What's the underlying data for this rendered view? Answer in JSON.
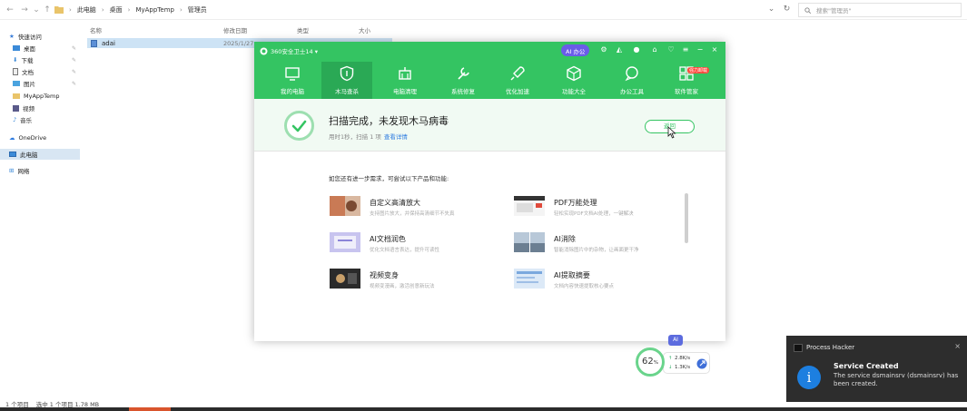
{
  "explorer": {
    "breadcrumbs": [
      "此电脑",
      "桌面",
      "MyAppTemp",
      "管理员"
    ],
    "search_placeholder": "搜索\"管理员\"",
    "columns": [
      "名称",
      "修改日期",
      "类型",
      "大小"
    ],
    "file": {
      "name": "adai",
      "date": "2025/1/27 ..."
    },
    "sidebar": [
      {
        "label": "快速访问",
        "icon": "star-icon"
      },
      {
        "label": "桌面",
        "icon": "desktop-icon",
        "pinned": true
      },
      {
        "label": "下载",
        "icon": "download-icon",
        "pinned": true
      },
      {
        "label": "文档",
        "icon": "document-icon",
        "pinned": true
      },
      {
        "label": "图片",
        "icon": "picture-icon",
        "pinned": true
      },
      {
        "label": "MyAppTemp",
        "icon": "folder-icon"
      },
      {
        "label": "视频",
        "icon": "video-icon"
      },
      {
        "label": "音乐",
        "icon": "music-icon"
      },
      {
        "label": "OneDrive",
        "icon": "cloud-icon"
      },
      {
        "label": "此电脑",
        "icon": "computer-icon",
        "selected": true
      },
      {
        "label": "网络",
        "icon": "network-icon"
      }
    ],
    "status": [
      "1 个项目",
      "选中 1 个项目 1.78 MB"
    ]
  },
  "app360": {
    "title": "360安全卫士14 ▾",
    "ai_button": "AI 办公",
    "tabs": [
      {
        "label": "我的电脑",
        "icon": "monitor-icon"
      },
      {
        "label": "木马查杀",
        "icon": "shield-icon",
        "selected": true
      },
      {
        "label": "电脑清理",
        "icon": "broom-icon"
      },
      {
        "label": "系统修复",
        "icon": "wrench-icon"
      },
      {
        "label": "优化加速",
        "icon": "rocket-icon"
      },
      {
        "label": "功能大全",
        "icon": "cube-icon"
      },
      {
        "label": "办公工具",
        "icon": "bubble-icon"
      },
      {
        "label": "软件管家",
        "icon": "apps-icon",
        "badge": "强力卸载"
      }
    ],
    "scan": {
      "title": "扫描完成，未发现木马病毒",
      "detail": "用时1秒，扫描 1 项",
      "link": "查看详情",
      "button": "返回"
    },
    "promo_heading": "如您还有进一步需求，可尝试以下产品和功能:",
    "promos": [
      {
        "title": "自定义高清放大",
        "desc": "支持图片放大，并保持高清细节不失真"
      },
      {
        "title": "PDF万能处理",
        "desc": "轻松实现PDF文档AI处理，一键解决"
      },
      {
        "title": "AI文档润色",
        "desc": "优化文档语言表达，提升可读性"
      },
      {
        "title": "AI消除",
        "desc": "智能消除图片中的杂物，让画面更干净"
      },
      {
        "title": "视频变身",
        "desc": "视频变漫画，激活创意新玩法"
      },
      {
        "title": "AI提取摘要",
        "desc": "文档内容快速提取核心要点"
      }
    ]
  },
  "widget": {
    "ai_label": "AI",
    "percent": "62",
    "percent_unit": "%",
    "up": "2.8K/s",
    "down": "1.3K/s"
  },
  "toast": {
    "app": "Process Hacker",
    "title": "Service Created",
    "body": "The service dsmainsrv (dsmainsrv) has been created."
  },
  "colors": {
    "brand_green": "#34c462",
    "selected_tab": "#2aa955",
    "link_blue": "#2f7ce0",
    "toast_bg": "#2d2d2d",
    "info_blue": "#1d7fe0"
  }
}
